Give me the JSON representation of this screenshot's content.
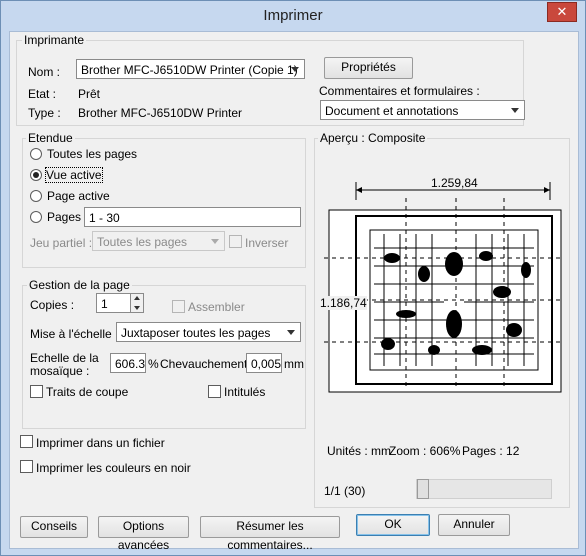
{
  "window": {
    "title": "Imprimer",
    "close_glyph": "✕"
  },
  "printer": {
    "group_label": "Imprimante",
    "name_label": "Nom :",
    "name_value": "Brother MFC-J6510DW Printer (Copie 1)",
    "state_label": "Etat :",
    "state_value": "Prêt",
    "type_label": "Type :",
    "type_value": "Brother MFC-J6510DW Printer",
    "properties_button": "Propriétés",
    "comments_label": "Commentaires et formulaires :",
    "comments_value": "Document et annotations"
  },
  "range": {
    "group_label": "Etendue",
    "all_pages": "Toutes les pages",
    "current_view": "Vue active",
    "current_page": "Page active",
    "pages": "Pages",
    "pages_value": "1 - 30",
    "subset_label": "Jeu partiel :",
    "subset_value": "Toutes les pages",
    "reverse": "Inverser",
    "selected": "current_view"
  },
  "handling": {
    "group_label": "Gestion de la page",
    "copies_label": "Copies :",
    "copies_value": "1",
    "collate": "Assembler",
    "scale_label": "Mise à l'échelle :",
    "scale_value": "Juxtaposer toutes les pages",
    "tile_scale_label_1": "Echelle de la",
    "tile_scale_label_2": "mosaïque :",
    "tile_scale_value": "606.3",
    "percent": "%",
    "overlap_label": "Chevauchement :",
    "overlap_value": "0,005",
    "mm": "mm",
    "cut_marks": "Traits de coupe",
    "labels": "Intitulés"
  },
  "options": {
    "print_to_file": "Imprimer dans un fichier",
    "print_black": "Imprimer les couleurs en noir"
  },
  "preview": {
    "label": "Aperçu : Composite",
    "width": "1.259,84",
    "height": "1.186,74",
    "units": "Unités : mm",
    "zoom": "Zoom : 606%",
    "pages": "Pages : 12",
    "page_counter": "1/1 (30)"
  },
  "buttons": {
    "tips": "Conseils",
    "advanced": "Options avancées",
    "summarize": "Résumer les commentaires...",
    "ok": "OK",
    "cancel": "Annuler"
  }
}
